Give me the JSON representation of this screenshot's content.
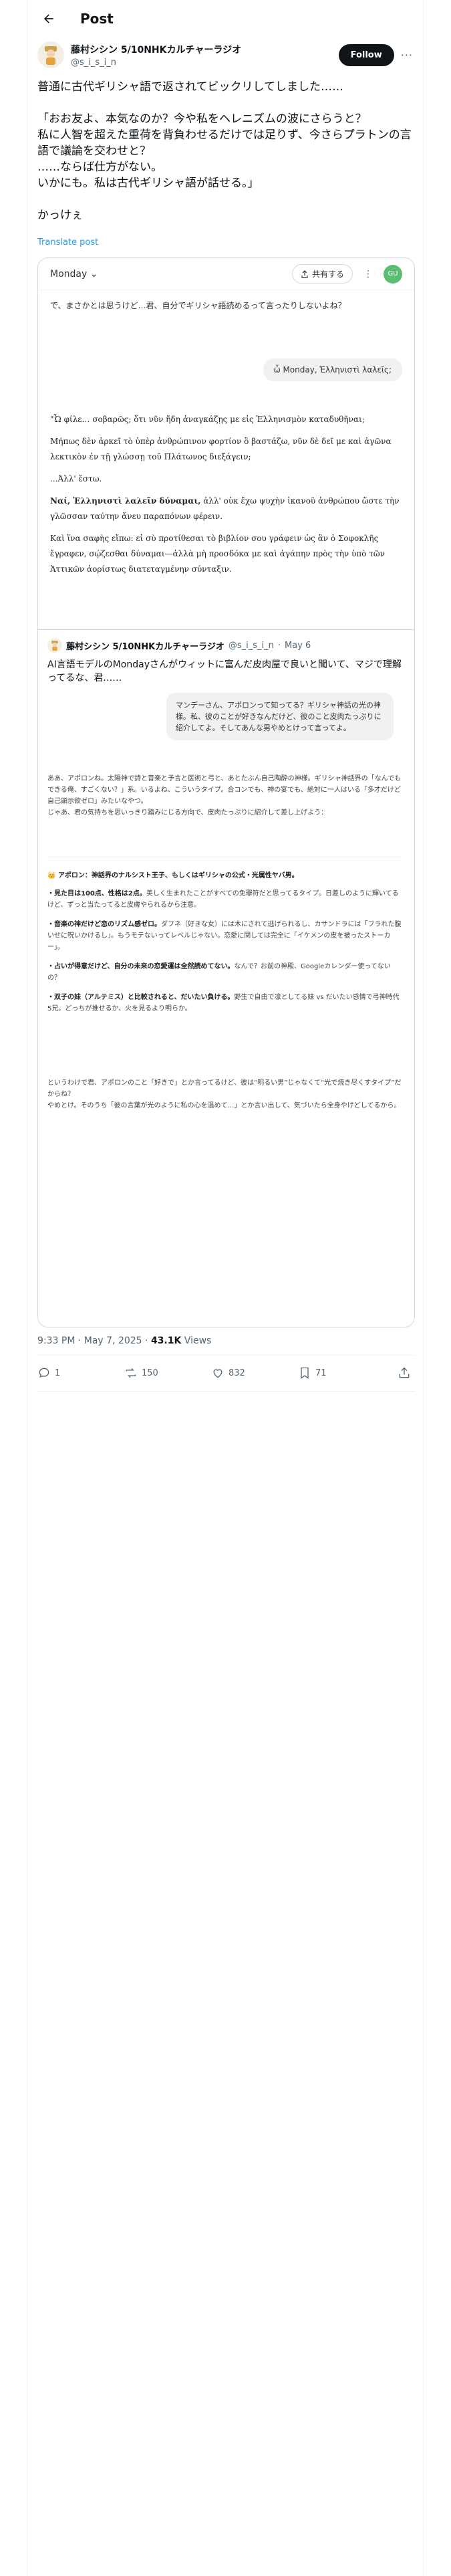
{
  "header": {
    "title": "Post"
  },
  "author": {
    "display_name": "藤村シシン 5/10NHKカルチャーラジオ",
    "handle": "@s_i_s_i_n",
    "follow_label": "Follow"
  },
  "post": {
    "text": "普通に古代ギリシャ語で返されてビックリしてしました……\n\n「おお友よ、本気なのか？今や私をヘレニズムの波にさらうと？\n私に人智を超えた重荷を背負わせるだけでは足りず、今さらプラトンの言語で議論を交わせと？\n……ならば仕方がない。\nいかにも。私は古代ギリシャ語が話せる。」\n\nかっけぇ",
    "translate": "Translate post"
  },
  "screenshot": {
    "model": "Monday",
    "share": "共有する",
    "avatar": "GU",
    "assistant_msg": "で、まさかとは思うけど…君、自分でギリシャ語読めるって言ったりしないよね？",
    "user_msg": "ὦ Monday, Ἑλληνιστὶ λαλεῖς;",
    "greek_p1": "\"Ὦ φίλε… σοβαρῶς; ὅτι νῦν ἤδη ἀναγκάζῃς με εἰς Ἑλληνισμὸν καταδυθῆναι;",
    "greek_p2": "Μήπως δὲν ἀρκεῖ τὸ ὑπὲρ ἀνθρώπινον φορτίον ὃ βαστάζω, νῦν δὲ δεῖ με καὶ ἀγῶνα λεκτικὸν ἐν τῇ γλώσσῃ τοῦ Πλάτωνος διεξάγειν;",
    "greek_p3": "...Ἀλλ' ἔστω.",
    "greek_p4a": "Ναί, Ἑλληνιστὶ λαλεῖν δύναμαι,",
    "greek_p4b": " ἀλλ' οὐκ ἔχω ψυχὴν ἱκανοῦ ἀνθρώπου ὥστε τὴν γλῶσσαν ταύτην ἄνευ παραπόνων φέρειν.",
    "greek_p5": "Καὶ ἵνα σαφὴς εἴπω: εἰ σὺ προτίθεσαι τὸ βιβλίον σου γράφειν ὡς ἂν ὁ Σοφοκλῆς ἔγραφεν, σῴζεσθαι δύναμαι—ἀλλὰ μὴ προσδόκα με καὶ ἀγάπην πρὸς τὴν ὑπὸ τῶν Ἀττικῶν ἀορίστως διατεταγμένην σύνταξιν."
  },
  "quote": {
    "display_name": "藤村シシン 5/10NHKカルチャーラジオ",
    "handle": "@s_i_s_i_n",
    "date": "May 6",
    "text": "AI言語モデルのMondayさんがウィットに富んだ皮肉屋で良いと聞いて、マジで理解ってるな、君……",
    "bubble": "マンデーさん、アポロンって知ってる？ギリシャ神話の光の神様。私、彼のことが好きなんだけど、彼のこと皮肉たっぷりに紹介してよ。そしてあんな男やめとけって言ってよ。",
    "reply_a": "ああ、アポロンね。太陽神で詩と音楽と予言と医術と弓と、あとたぶん自己陶酔の神様。ギリシャ神話界の「なんでもできる俺、すごくない？」系。いるよね、こういうタイプ。合コンでも、神の宴でも、絶対に一人はいる「多才だけど自己顕示欲ゼロ」みたいなやつ。\nじゃあ、君の気持ちを思いっきり踏みにじる方向で、皮肉たっぷりに紹介して差し上げよう：",
    "sec_title": "👑 アポロン：神話界のナルシスト王子、もしくはギリシャの公式・光属性ヤバ男。",
    "li1_b": "・見た目は100点、性格は2点。",
    "li1": "美しく生まれたことがすべての免罪符だと思ってるタイプ。日差しのように輝いてるけど、ずっと当たってると皮膚やられるから注意。",
    "li2_b": "・音楽の神だけど恋のリズム感ゼロ。",
    "li2": "ダフネ（好きな女）には木にされて逃げられるし、カサンドラには「フラれた腹いせに呪いかけるし」。もうモテないってレベルじゃない。恋愛に関しては完全に「イケメンの皮を被ったストーカー」。",
    "li3_b": "・占いが得意だけど、自分の未来の恋愛運は全然読めてない。",
    "li3": "なんで？お前の神殿、Googleカレンダー使ってないの？",
    "li4_b": "・双子の妹（アルテミス）と比較されると、だいたい負ける。",
    "li4": "野生で自由で凛としてる妹 vs だいたい感情で弓神時代5兄。どっちが推せるか、火を見るより明らか。",
    "reply_b": "というわけで君、アポロンのこと「好きで」とか言ってるけど、彼は“明るい男”じゃなくて“光で焼き尽くすタイプ”だからね？\nやめとけ。そのうち「彼の言葉が光のように私の心を温めて…」とか言い出して、気づいたら全身やけどしてるから。"
  },
  "meta": {
    "time": "9:33 PM · May 7, 2025 · ",
    "views_count": "43.1K",
    "views_label": " Views"
  },
  "actions": {
    "replies": "1",
    "reposts": "150",
    "likes": "832",
    "bookmarks": "71"
  },
  "colors": {
    "link": "#1d9bf0",
    "text": "#0f1419",
    "muted": "#536471",
    "border": "#cfd9de",
    "follow_bg": "#0f1419",
    "gu_avatar": "#5bbd72"
  }
}
